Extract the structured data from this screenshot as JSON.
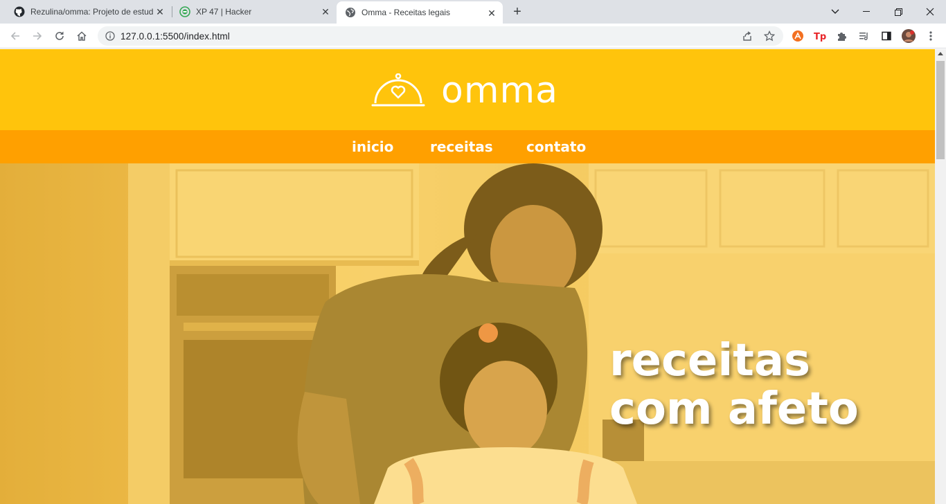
{
  "browser": {
    "tabs": [
      {
        "title": "Rezulina/omma: Projeto de estud",
        "icon": "github-icon"
      },
      {
        "title": "XP 47 | Hacker",
        "icon": "hacker-icon"
      },
      {
        "title": "Omma - Receitas legais",
        "icon": "globe-icon"
      }
    ],
    "active_tab": 2,
    "url": "127.0.0.1:5500/index.html"
  },
  "site": {
    "brand": "omma",
    "colors": {
      "header": "#ffc40c",
      "nav": "#ffa000",
      "text": "#ffffff"
    },
    "nav": [
      {
        "label": "inicio"
      },
      {
        "label": "receitas"
      },
      {
        "label": "contato"
      }
    ],
    "hero": {
      "line1": "receitas",
      "line2": "com afeto"
    }
  }
}
